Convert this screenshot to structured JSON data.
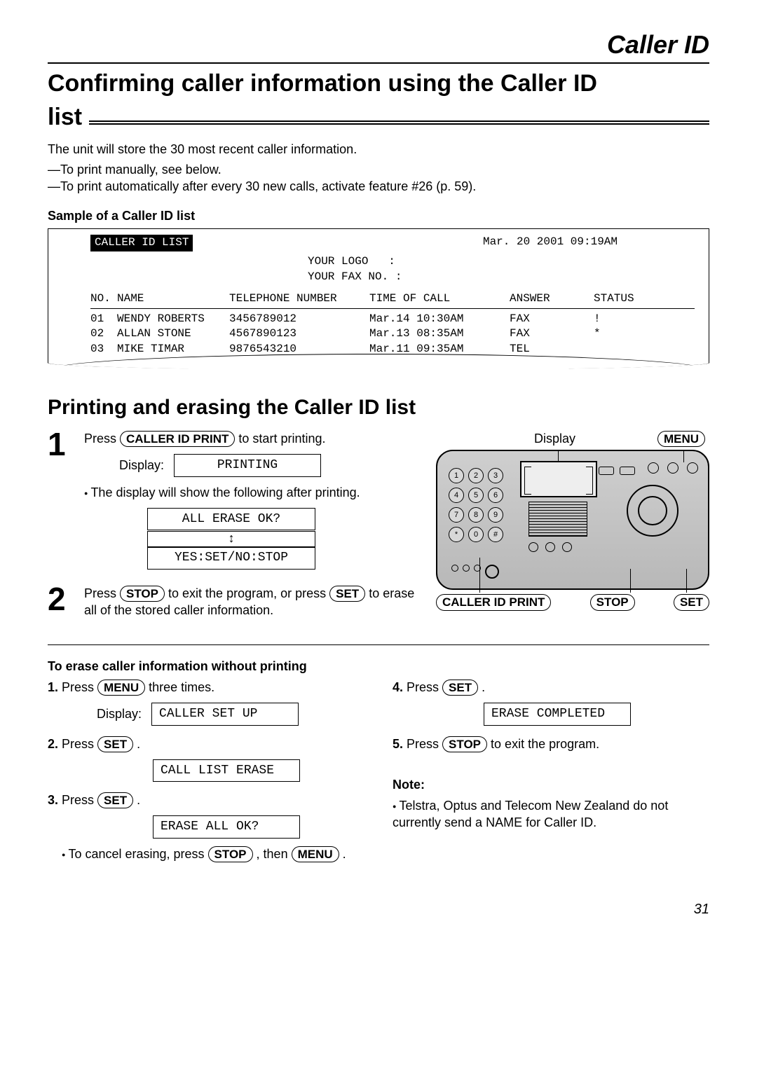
{
  "header": {
    "title": "Caller ID"
  },
  "section1": {
    "title_line1": "Confirming caller information using the Caller ID",
    "title_line2_word": "list"
  },
  "intro": {
    "p1": "The unit will store the 30 most recent caller information.",
    "p2": "—To print manually, see below.",
    "p3": "—To print automatically after every 30 new calls, activate feature #26 (p. 59)."
  },
  "sample": {
    "heading": "Sample of a Caller ID list",
    "banner": "CALLER ID LIST",
    "timestamp": "Mar. 20 2001 09:19AM",
    "your_logo_label": "YOUR LOGO",
    "your_fax_label": "YOUR FAX NO.",
    "colon": ":",
    "cols": {
      "no": "NO.",
      "name": "NAME",
      "tel": "TELEPHONE NUMBER",
      "time": "TIME OF CALL",
      "answer": "ANSWER",
      "status": "STATUS"
    },
    "rows": [
      {
        "no": "01",
        "name": "WENDY ROBERTS",
        "tel": "3456789012",
        "time": "Mar.14 10:30AM",
        "answer": "FAX",
        "status": "!"
      },
      {
        "no": "02",
        "name": "ALLAN STONE",
        "tel": "4567890123",
        "time": "Mar.13 08:35AM",
        "answer": "FAX",
        "status": "*"
      },
      {
        "no": "03",
        "name": "MIKE TIMAR",
        "tel": "9876543210",
        "time": "Mar.11 09:35AM",
        "answer": "TEL",
        "status": ""
      }
    ]
  },
  "section2": {
    "title": "Printing and erasing the Caller ID list"
  },
  "keys": {
    "caller_id_print": "CALLER ID PRINT",
    "stop": "STOP",
    "set": "SET",
    "menu": "MENU"
  },
  "labels": {
    "display": "Display",
    "display_colon": "Display:"
  },
  "step1": {
    "pre": "Press ",
    "post": " to start printing.",
    "lcd_printing": "PRINTING",
    "after_text": "The display will show the following after printing.",
    "lcd_erase": "ALL ERASE OK?",
    "lcd_yesno": "YES:SET/NO:STOP"
  },
  "step2": {
    "t1": "Press ",
    "t2": " to exit the program, or press ",
    "t3": " to erase all of the stored caller information."
  },
  "erase_section": {
    "heading": "To erase caller information without printing",
    "s1_pre": "Press ",
    "s1_post": " three times.",
    "lcd1": "CALLER SET UP",
    "s2_pre": "Press ",
    "s2_post": ".",
    "lcd2": "CALL LIST ERASE",
    "s3_pre": "Press ",
    "s3_post": ".",
    "lcd3": "ERASE ALL OK?",
    "cancel_pre": "To cancel erasing, press ",
    "cancel_mid": ", then ",
    "cancel_post": ".",
    "s4_pre": "Press ",
    "s4_post": ".",
    "lcd4": "ERASE COMPLETED",
    "s5_pre": "Press ",
    "s5_post": " to exit the program."
  },
  "note": {
    "heading": "Note:",
    "body": "Telstra, Optus and Telecom New Zealand do not currently send a NAME for Caller ID."
  },
  "nums": {
    "n1": "1.",
    "n2": "2.",
    "n3": "3.",
    "n4": "4.",
    "n5": "5."
  },
  "bignums": {
    "one": "1",
    "two": "2"
  },
  "keypad": [
    "1",
    "2",
    "3",
    "4",
    "5",
    "6",
    "7",
    "8",
    "9",
    "*",
    "0",
    "#"
  ],
  "page_number": "31"
}
